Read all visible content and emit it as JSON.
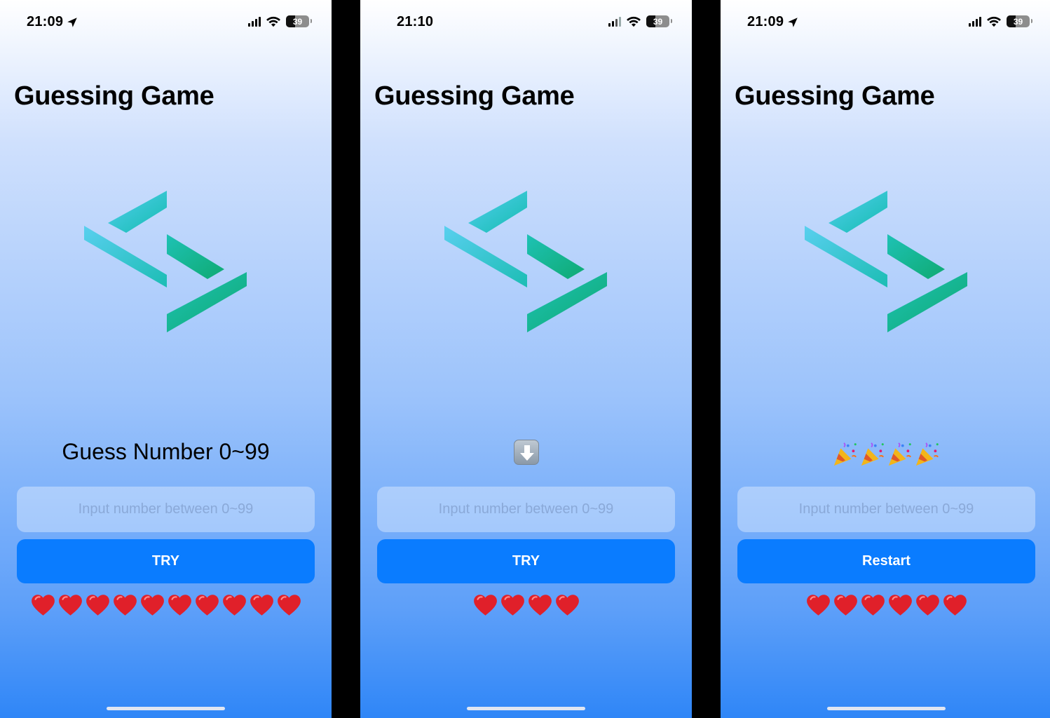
{
  "colors": {
    "accent": "#0a7cff",
    "heart": "#e0202a",
    "logo_cyan": "#4cc9e8",
    "logo_green": "#10b27e"
  },
  "screens": [
    {
      "status": {
        "time": "21:09",
        "location_icon": true,
        "battery": "39"
      },
      "title": "Guessing Game",
      "message": {
        "kind": "text",
        "text": "Guess Number 0~99"
      },
      "input": {
        "value": "",
        "placeholder": "Input number between 0~99"
      },
      "button": {
        "label": "TRY"
      },
      "lives": 10
    },
    {
      "status": {
        "time": "21:10",
        "location_icon": false,
        "battery": "39"
      },
      "title": "Guessing Game",
      "message": {
        "kind": "icon",
        "icon": "down-arrow-icon"
      },
      "input": {
        "value": "",
        "placeholder": "Input number between 0~99"
      },
      "button": {
        "label": "TRY"
      },
      "lives": 4
    },
    {
      "status": {
        "time": "21:09",
        "location_icon": true,
        "battery": "39"
      },
      "title": "Guessing Game",
      "message": {
        "kind": "icon-repeat",
        "icon": "party-popper-icon",
        "count": 4
      },
      "input": {
        "value": "",
        "placeholder": "Input number between 0~99"
      },
      "button": {
        "label": "Restart"
      },
      "lives": 6
    }
  ]
}
